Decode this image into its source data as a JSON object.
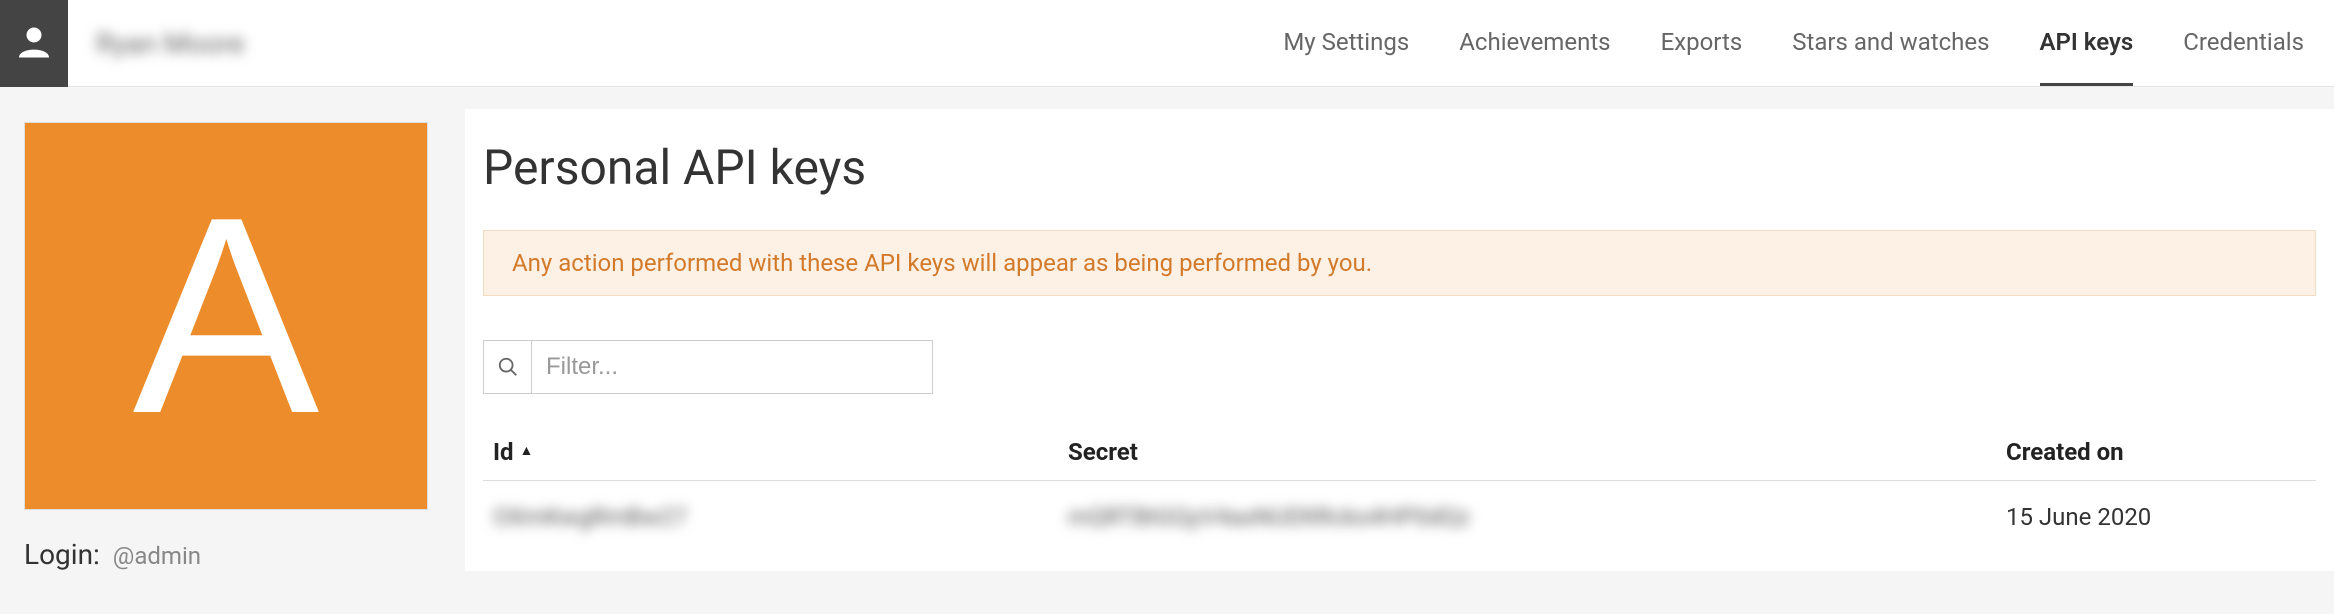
{
  "header": {
    "username_blurred": "Ryan Moore"
  },
  "nav": {
    "items": [
      {
        "label": "My Settings",
        "active": false
      },
      {
        "label": "Achievements",
        "active": false
      },
      {
        "label": "Exports",
        "active": false
      },
      {
        "label": "Stars and watches",
        "active": false
      },
      {
        "label": "API keys",
        "active": true
      },
      {
        "label": "Credentials",
        "active": false
      }
    ]
  },
  "sidebar": {
    "avatar_letter": "A",
    "login_label": "Login:",
    "login_handle": "@admin"
  },
  "main": {
    "title": "Personal API keys",
    "notice": "Any action performed with these API keys will appear as being performed by you.",
    "filter_placeholder": "Filter...",
    "columns": {
      "id": "Id",
      "secret": "Secret",
      "created": "Created on"
    },
    "rows": [
      {
        "id_blurred": "OXmKwgRmBw27",
        "secret_blurred": "mQRTBtGQyV4axNUDltRcks4HP0dQz",
        "created": "15 June 2020"
      }
    ]
  }
}
